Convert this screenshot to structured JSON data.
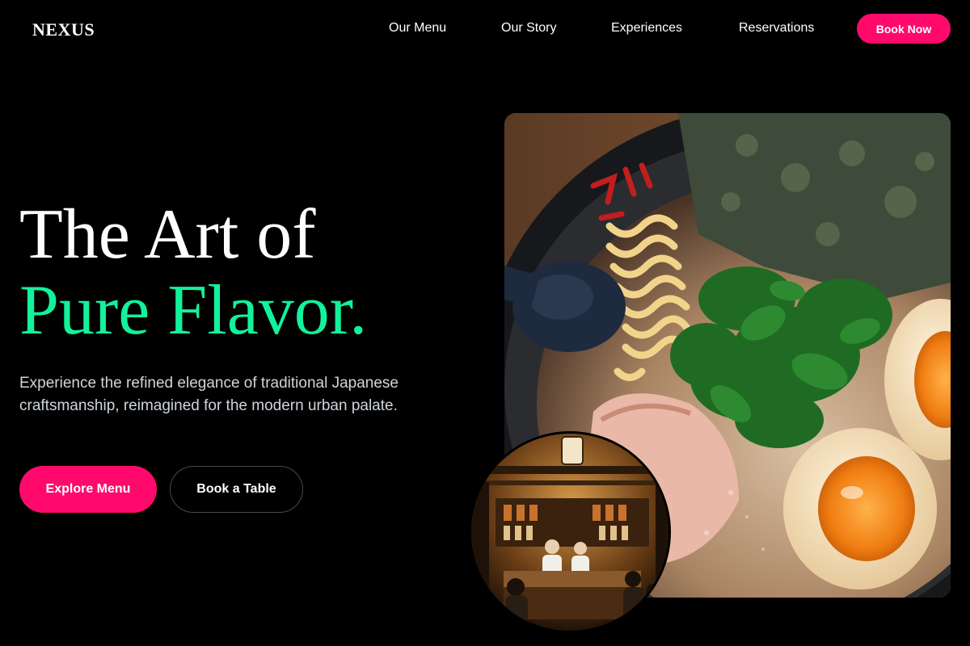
{
  "brand": {
    "logo": "NEXUS"
  },
  "nav": {
    "links": [
      "Our Menu",
      "Our Story",
      "Experiences",
      "Reservations"
    ],
    "cta": "Book Now"
  },
  "hero": {
    "headline_line1": "The Art of",
    "headline_line2": "Pure Flavor.",
    "subtext": "Experience the refined elegance of traditional Japanese craftsmanship, reimagined for the modern urban palate.",
    "primary_button": "Explore Menu",
    "secondary_button": "Book a Table"
  },
  "images": {
    "main_dish": "ramen-bowl-photo",
    "secondary": "restaurant-interior-photo"
  },
  "colors": {
    "background": "#000000",
    "accent_pink": "#ff0a6c",
    "accent_green": "#12f29a",
    "text_primary": "#ffffff",
    "text_muted": "#cfd4dc"
  }
}
